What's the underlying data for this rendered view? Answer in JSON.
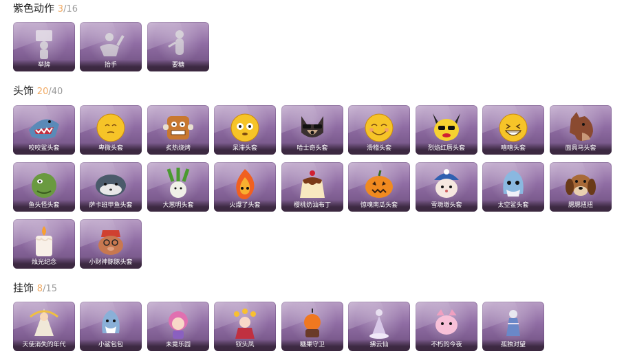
{
  "sections": [
    {
      "title": "紫色动作",
      "owned": "3",
      "total": "16",
      "items": [
        {
          "label": "举牌",
          "icon": "sign-pose-icon"
        },
        {
          "label": "抬手",
          "icon": "raise-hand-pose-icon"
        },
        {
          "label": "要糖",
          "icon": "ask-candy-pose-icon"
        }
      ]
    },
    {
      "title": "头饰",
      "owned": "20",
      "total": "40",
      "items": [
        {
          "label": "咬咬鲨头套",
          "icon": "shark-head-icon"
        },
        {
          "label": "卑微头套",
          "icon": "shy-emoji-head-icon"
        },
        {
          "label": "炙热烧烤",
          "icon": "bbq-toast-head-icon"
        },
        {
          "label": "呆滞头套",
          "icon": "dazed-emoji-head-icon"
        },
        {
          "label": "哈士奇头套",
          "icon": "husky-head-icon"
        },
        {
          "label": "滑稽头套",
          "icon": "grin-emoji-head-icon"
        },
        {
          "label": "烈焰红唇头套",
          "icon": "pikachu-lips-head-icon"
        },
        {
          "label": "嘻嘻头套",
          "icon": "laugh-emoji-head-icon"
        },
        {
          "label": "面具马头套",
          "icon": "horse-mask-head-icon"
        },
        {
          "label": "鱼头怪头套",
          "icon": "fish-monster-head-icon"
        },
        {
          "label": "萨卡班甲鱼头套",
          "icon": "sacabambaspis-head-icon"
        },
        {
          "label": "大葱明头套",
          "icon": "scallion-head-icon"
        },
        {
          "label": "火爆了头套",
          "icon": "fire-head-icon"
        },
        {
          "label": "樱桃奶油布丁",
          "icon": "pudding-head-icon"
        },
        {
          "label": "惊魂南瓜头套",
          "icon": "pumpkin-head-icon"
        },
        {
          "label": "雪墩墩头套",
          "icon": "snow-bear-head-icon"
        },
        {
          "label": "太空鲨头套",
          "icon": "space-shark-head-icon"
        },
        {
          "label": "腮腮扭扭",
          "icon": "dog-head-icon"
        },
        {
          "label": "烛光纪念",
          "icon": "candle-head-icon"
        },
        {
          "label": "小财神豚豚头套",
          "icon": "pig-fortune-head-icon"
        }
      ]
    },
    {
      "title": "挂饰",
      "owned": "8",
      "total": "15",
      "items": [
        {
          "label": "天使消失的年代",
          "icon": "angel-pendant-icon"
        },
        {
          "label": "小鲨包包",
          "icon": "shark-bag-pendant-icon"
        },
        {
          "label": "未竟乐园",
          "icon": "pink-girl-pendant-icon"
        },
        {
          "label": "钗头凤",
          "icon": "flower-girl-pendant-icon"
        },
        {
          "label": "糖果守卫",
          "icon": "candy-guard-pendant-icon"
        },
        {
          "label": "拂云仙",
          "icon": "cloud-fairy-pendant-icon"
        },
        {
          "label": "不朽的今夜",
          "icon": "pink-cat-pendant-icon"
        },
        {
          "label": "孤独对望",
          "icon": "lonely-gaze-pendant-icon"
        }
      ]
    }
  ],
  "colors": {
    "accent_owned": "#f0a860",
    "card_top": "#b79cc4",
    "card_bottom": "#6d4f7e"
  }
}
